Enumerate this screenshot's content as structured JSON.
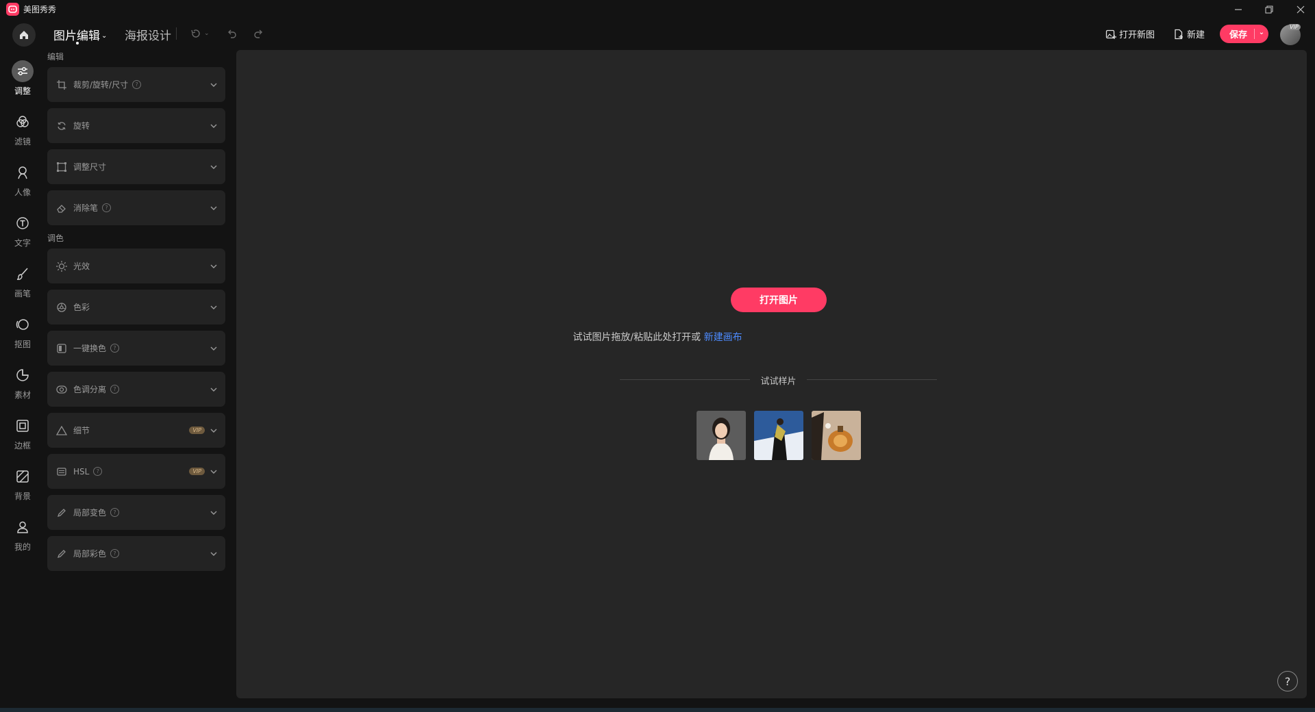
{
  "app": {
    "title": "美图秀秀"
  },
  "header": {
    "tabs": [
      {
        "label": "图片编辑",
        "active": true
      },
      {
        "label": "海报设计",
        "active": false
      }
    ],
    "open_new_label": "打开新图",
    "new_label": "新建",
    "save_label": "保存",
    "vip_tag": "VIP"
  },
  "rail": [
    {
      "label": "调整",
      "icon": "sliders-icon",
      "active": true
    },
    {
      "label": "滤镜",
      "icon": "filter-circles-icon"
    },
    {
      "label": "人像",
      "icon": "portrait-icon"
    },
    {
      "label": "文字",
      "icon": "text-icon"
    },
    {
      "label": "画笔",
      "icon": "brush-icon"
    },
    {
      "label": "抠图",
      "icon": "cutout-icon"
    },
    {
      "label": "素材",
      "icon": "sticker-icon"
    },
    {
      "label": "边框",
      "icon": "frame-icon"
    },
    {
      "label": "背景",
      "icon": "background-icon"
    },
    {
      "label": "我的",
      "icon": "user-icon"
    }
  ],
  "panel": {
    "edit_section": "编辑",
    "color_section": "调色",
    "edit_tools": [
      {
        "label": "裁剪/旋转/尺寸",
        "icon": "crop-icon",
        "help": true
      },
      {
        "label": "旋转",
        "icon": "rotate-icon"
      },
      {
        "label": "调整尺寸",
        "icon": "resize-icon"
      },
      {
        "label": "消除笔",
        "icon": "eraser-icon",
        "help": true
      }
    ],
    "color_tools": [
      {
        "label": "光效",
        "icon": "sun-icon"
      },
      {
        "label": "色彩",
        "icon": "palette-icon"
      },
      {
        "label": "一键换色",
        "icon": "color-swap-icon",
        "help": true
      },
      {
        "label": "色调分离",
        "icon": "split-tone-icon",
        "help": true
      },
      {
        "label": "细节",
        "icon": "detail-icon",
        "vip": "VIP"
      },
      {
        "label": "HSL",
        "icon": "hsl-icon",
        "help": true,
        "vip": "VIP"
      },
      {
        "label": "局部变色",
        "icon": "pen-icon",
        "help": true
      },
      {
        "label": "局部彩色",
        "icon": "pen-icon",
        "help": true
      }
    ]
  },
  "canvas": {
    "open_image_label": "打开图片",
    "hint_text": "试试图片拖放/粘贴此处打开或 ",
    "hint_link": "新建画布",
    "samples_title": "试试样片",
    "help_label": "?"
  },
  "colors": {
    "accent": "#ff3b64",
    "link": "#4d8bff",
    "canvas": "#262626"
  }
}
